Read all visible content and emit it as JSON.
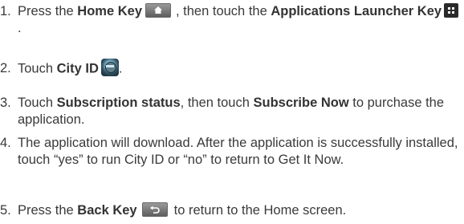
{
  "steps": [
    {
      "num": "1.",
      "t1": "Press the ",
      "b1": "Home Key",
      "t2": ", then touch the ",
      "b2": "Applications Launcher Key",
      "t3": "."
    },
    {
      "num": "2.",
      "t1": "Touch ",
      "b1": "City ID",
      "t2": "."
    },
    {
      "num": "3.",
      "t1": "Touch ",
      "b1": "Subscription status",
      "t2": ", then touch ",
      "b2": "Subscribe Now",
      "t3": " to purchase the application."
    },
    {
      "num": "4.",
      "text": "The application will download. After the application is successfully installed, touch “yes” to run City ID or “no” to return to Get It Now."
    },
    {
      "num": "5.",
      "t1": "Press the ",
      "b1": "Back Key",
      "t2": "to return to the Home screen."
    }
  ],
  "icons": {
    "home_key": "home-key-icon",
    "apps_launcher_key": "applications-launcher-key-icon",
    "city_id": "city-id-app-icon",
    "back_key": "back-key-icon"
  },
  "colors": {
    "text": "#3a3a3a",
    "key_background": "#6e6e6e"
  }
}
